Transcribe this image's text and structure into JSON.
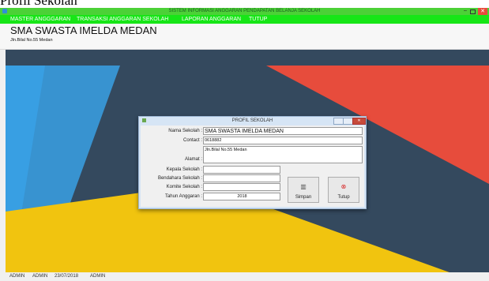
{
  "document_fragment": {
    "text": "Profil Sekolah"
  },
  "window": {
    "title": "SISTEM INFORMASI ANGGARAN PENDAPATAN BELANJA SEKOLAH",
    "minimize_glyph": "–",
    "close_glyph": "✕"
  },
  "menu": {
    "items": [
      {
        "label": "MASTER ANGGGARAN"
      },
      {
        "label": "TRANSAKSI ANGGARAN SEKOLAH"
      },
      {
        "label": "LAPORAN ANGGARAN"
      },
      {
        "label": "TUTUP"
      }
    ]
  },
  "header": {
    "school_name": "SMA SWASTA IMELDA MEDAN",
    "address": "Jln.Bilal No.55 Medan"
  },
  "dialog": {
    "title": "PROFIL SEKOLAH",
    "fields": {
      "nama_sekolah": {
        "label": "Nama Sekolah :",
        "value": "SMA SWASTA IMELDA MEDAN"
      },
      "contact": {
        "label": "Contact :",
        "value": "0618882"
      },
      "alamat": {
        "label": "Alamat :",
        "value": "Jln.Bilal No.55 Medan"
      },
      "kepala_sekolah": {
        "label": "Kepala Sekolah :",
        "value": ""
      },
      "bendahara_sekolah": {
        "label": "Bendahara Sekolah :",
        "value": ""
      },
      "komite_sekolah": {
        "label": "Komite Sekolah :",
        "value": ""
      },
      "tahun_anggaran": {
        "label": "Tahun Anggaran :",
        "value": "2018"
      }
    },
    "buttons": {
      "simpan": {
        "label": "Simpan",
        "icon": "save-icon"
      },
      "tutup": {
        "label": "Tutup",
        "icon": "close-circle-icon"
      }
    }
  },
  "status_bar": {
    "user_1": "ADMIN",
    "user_2": "ADMIN",
    "date": "23/07/2018",
    "role": "ADMIN"
  },
  "colors": {
    "titlebar": "#4cd137",
    "menubar": "#17e617",
    "wallpaper_dark": "#34495e",
    "wallpaper_blue": "#3498db",
    "wallpaper_red": "#e74c3c",
    "wallpaper_yellow": "#f1c40f"
  }
}
